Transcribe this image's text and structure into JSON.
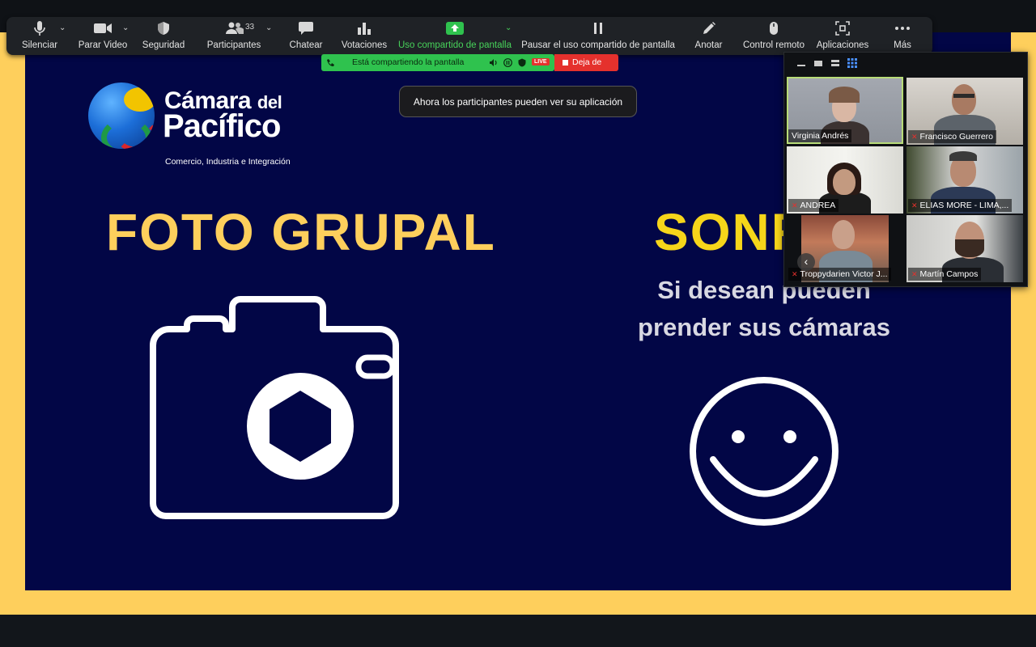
{
  "toolbar": {
    "mute_label": "Silenciar",
    "video_label": "Parar Video",
    "security_label": "Seguridad",
    "participants_label": "Participantes",
    "participants_count": "33",
    "chat_label": "Chatear",
    "polls_label": "Votaciones",
    "share_label": "Uso compartido de pantalla",
    "pause_label": "Pausar el uso compartido de pantalla",
    "annotate_label": "Anotar",
    "remote_label": "Control remoto",
    "apps_label": "Aplicaciones",
    "more_label": "Más"
  },
  "share_bar": {
    "status_text": "Está compartiendo la pantalla",
    "live_badge": "LIVE",
    "stop_label": "Deja de"
  },
  "tooltip": {
    "text": "Ahora los participantes pueden ver su aplicación"
  },
  "slide": {
    "logo_line1_a": "Cámara",
    "logo_line1_b": "del",
    "logo_line2": "Pacífico",
    "logo_tagline": "Comercio, Industria e Integración",
    "title_left": "FOTO GRUPAL",
    "title_right": "SONRÍ",
    "subtitle_line1": "Si desean pueden",
    "subtitle_line2": "prender sus cámaras"
  },
  "video_panel": {
    "participants": [
      {
        "name": "Virginia Andrés",
        "muted": false,
        "active": true
      },
      {
        "name": "Francisco Guerrero",
        "muted": true,
        "active": false
      },
      {
        "name": "ANDREA",
        "muted": true,
        "active": false
      },
      {
        "name": "ELIAS MORE - LIMA,...",
        "muted": true,
        "active": false
      },
      {
        "name": "Troppydarien Victor J...",
        "muted": true,
        "active": false
      },
      {
        "name": "Martín Campos",
        "muted": true,
        "active": false
      }
    ]
  },
  "colors": {
    "slide_background": "#020646",
    "slide_border": "#fecf5c",
    "title_yellow": "#fecf5c",
    "share_green": "#2fc24e",
    "stop_red": "#e5312d"
  }
}
